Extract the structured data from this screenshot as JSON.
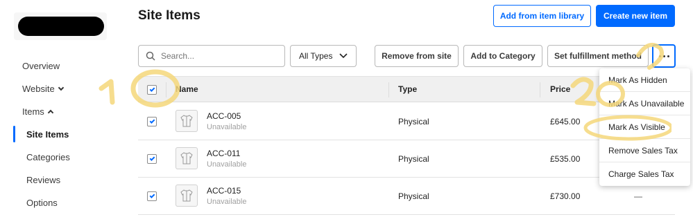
{
  "sidebar": {
    "items": [
      {
        "label": "Overview"
      },
      {
        "label": "Website"
      },
      {
        "label": "Items"
      },
      {
        "label": "Site Items"
      },
      {
        "label": "Categories"
      },
      {
        "label": "Reviews"
      },
      {
        "label": "Options"
      }
    ]
  },
  "header": {
    "title": "Site Items",
    "add_library_label": "Add from item library",
    "create_label": "Create new item"
  },
  "toolbar": {
    "search_placeholder": "Search...",
    "type_filter": "All Types",
    "remove_label": "Remove from site",
    "add_category_label": "Add to Category",
    "fulfillment_label": "Set fulfillment method"
  },
  "table": {
    "columns": [
      "Name",
      "Type",
      "Price"
    ],
    "rows": [
      {
        "sku": "ACC-005",
        "status": "Unavailable",
        "type": "Physical",
        "price": "£645.00",
        "extra": ""
      },
      {
        "sku": "ACC-011",
        "status": "Unavailable",
        "type": "Physical",
        "price": "£535.00",
        "extra": ""
      },
      {
        "sku": "ACC-015",
        "status": "Unavailable",
        "type": "Physical",
        "price": "£730.00",
        "extra": "—"
      }
    ]
  },
  "menu": {
    "items": [
      "Mark As Hidden",
      "Mark As Unavailable",
      "Mark As Visible",
      "Remove Sales Tax",
      "Charge Sales Tax"
    ]
  },
  "annotations": {
    "first": "10",
    "second": "20"
  },
  "colors": {
    "accent": "#006aff",
    "annotation": "#f5d77a"
  }
}
